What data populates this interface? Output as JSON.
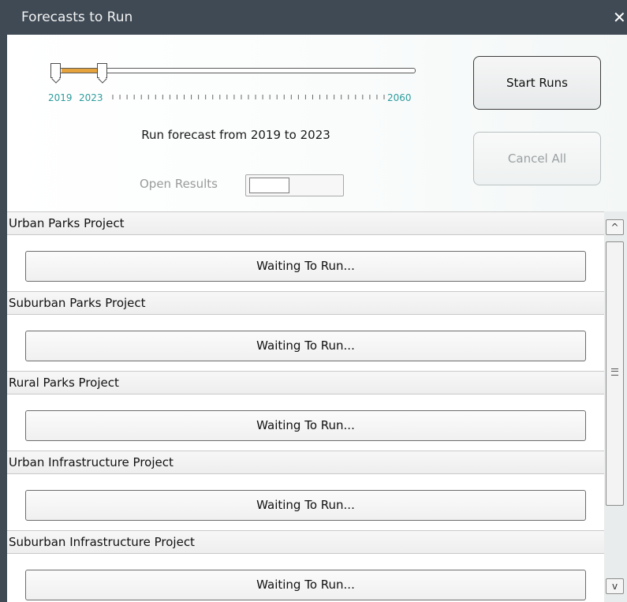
{
  "window": {
    "title": "Forecasts to Run",
    "close_icon": "close-icon"
  },
  "slider": {
    "start_label": "2019",
    "end_label": "2023",
    "max_label": "2060",
    "range_start": 2019,
    "range_end": 2023,
    "min": 2019,
    "max": 2060,
    "accent_color": "#e6a23c"
  },
  "run_text": "Run forecast from 2019 to 2023",
  "open_results": {
    "label": "Open Results",
    "enabled": false
  },
  "buttons": {
    "start": "Start Runs",
    "cancel": "Cancel All"
  },
  "projects": [
    {
      "name": "Urban Parks Project",
      "status": "Waiting To Run..."
    },
    {
      "name": "Suburban Parks Project",
      "status": "Waiting To Run..."
    },
    {
      "name": "Rural Parks Project",
      "status": "Waiting To Run..."
    },
    {
      "name": "Urban Infrastructure Project",
      "status": "Waiting To Run..."
    },
    {
      "name": "Suburban Infrastructure Project",
      "status": "Waiting To Run..."
    }
  ],
  "scrollbar": {
    "up_icon": "chevron-up-icon",
    "down_icon": "chevron-down-icon",
    "grip_icon": "grip-icon"
  }
}
